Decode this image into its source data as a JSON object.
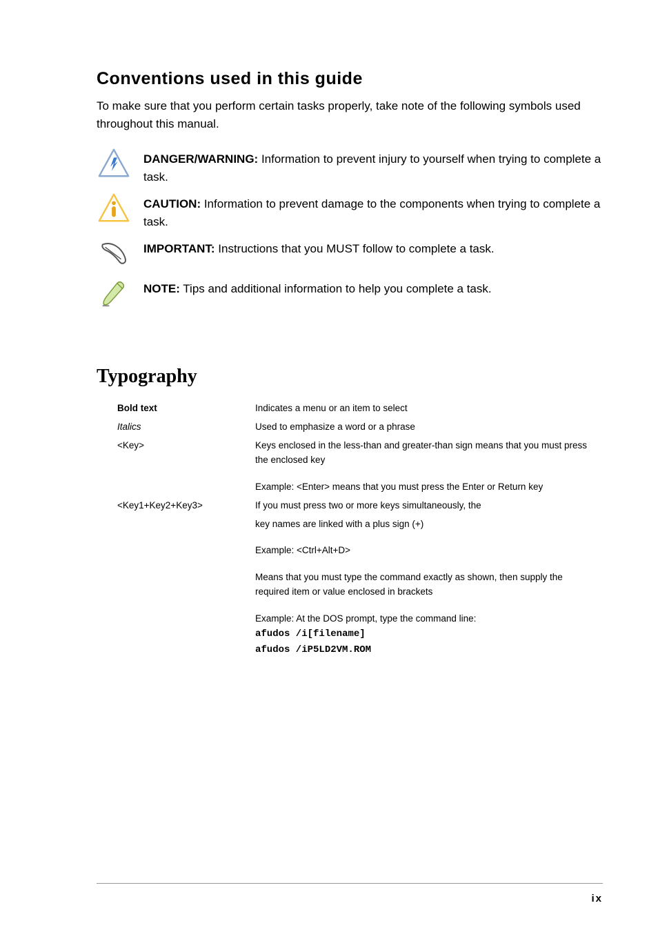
{
  "conventions": {
    "title": "Conventions used in this guide",
    "intro": "To make sure that you perform certain tasks properly, take note of the following symbols used throughout this manual.",
    "items": [
      {
        "label": "DANGER/WARNING:",
        "text": " Information to prevent injury to yourself when trying to complete a task."
      },
      {
        "label": "CAUTION:",
        "text": " Information to prevent damage to the components when trying to complete a task."
      },
      {
        "label": "IMPORTANT:",
        "text": " Instructions that you MUST follow to complete a task."
      },
      {
        "label": "NOTE:",
        "text": " Tips and additional information to help you complete a task."
      }
    ]
  },
  "typography": {
    "heading": "Typography",
    "rows": [
      {
        "term": "Bold text",
        "term_class": "bold-text",
        "desc": "Indicates a menu or an item to select"
      },
      {
        "term": "Italics",
        "term_class": "italic-text",
        "desc": "Used to emphasize a word or a phrase"
      },
      {
        "term": "<Key>",
        "term_class": "",
        "desc": "Keys enclosed in the less-than and greater-than sign means that you must press the enclosed key"
      }
    ],
    "example1": "Example: <Enter> means that you must press the Enter or Return key",
    "multikey_term": "<Key1+Key2+Key3>",
    "multikey_desc1": "If you must press two or more keys simultaneously, the",
    "multikey_desc2": "key names are linked with a plus sign (+)",
    "example2": "Example: <Ctrl+Alt+D>",
    "command_desc": "Means that you must type the command exactly as shown, then supply the required item or value enclosed in brackets",
    "example3_intro": "Example: At the DOS prompt, type the command line:",
    "command1": "afudos /i[filename]",
    "command2": "afudos /iP5LD2VM.ROM"
  },
  "page_number": "ix"
}
